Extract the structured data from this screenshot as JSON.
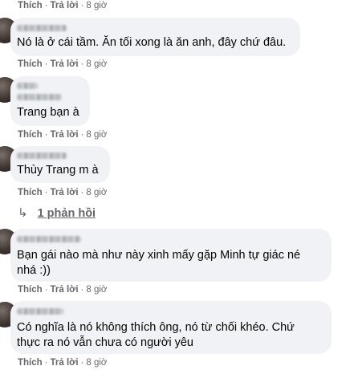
{
  "action_labels": {
    "like": "Thích",
    "reply": "Trả lời",
    "separator": "·"
  },
  "comments": [
    {
      "text": "",
      "time": "8 giờ"
    },
    {
      "text": "Nó là ở cái tầm. Ăn tối xong là ăn anh, đây chứ đâu.",
      "time": "8 giờ"
    },
    {
      "text": "Trang bạn à",
      "time": "8 giờ"
    },
    {
      "text": "Thùy Trang m à",
      "time": "8 giờ"
    },
    {
      "text": "Bạn gái nào mà như này xinh mấy gặp Minh tự giác né nhá :))",
      "time": "8 giờ"
    },
    {
      "text": "Có nghĩa là nó không thích ông, nó từ chối khéo. Chứ thực ra nó vẫn chưa có người yêu",
      "time": "8 giờ"
    }
  ],
  "view_replies": {
    "icon": "reply-arrow-icon",
    "label": "1 phản hồi"
  }
}
